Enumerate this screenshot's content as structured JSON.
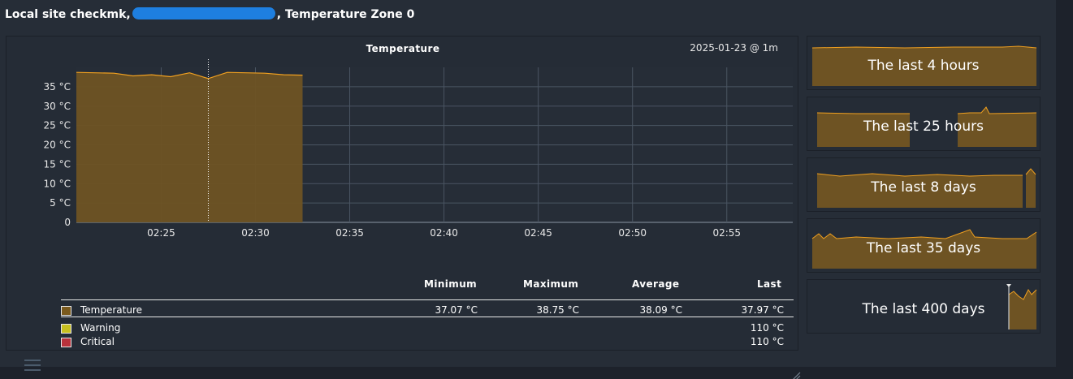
{
  "header": {
    "title_prefix": "Local site checkmk,",
    "title_suffix": ", Temperature Zone 0"
  },
  "graph": {
    "title": "Temperature",
    "date_label": "2025-01-23 @ 1m"
  },
  "legend": {
    "headers": [
      "Minimum",
      "Maximum",
      "Average",
      "Last"
    ],
    "rows": [
      {
        "label": "Temperature",
        "color": "#7a5a1e",
        "min": "37.07 °C",
        "max": "38.75 °C",
        "avg": "38.09 °C",
        "last": "37.97 °C"
      },
      {
        "label": "Warning",
        "color": "#c8c020",
        "min": "",
        "max": "",
        "avg": "",
        "last": "110 °C"
      },
      {
        "label": "Critical",
        "color": "#b8323c",
        "min": "",
        "max": "",
        "avg": "",
        "last": "110 °C"
      }
    ]
  },
  "timeranges": [
    {
      "label": "The last 4 hours"
    },
    {
      "label": "The last 25 hours"
    },
    {
      "label": "The last 8 days"
    },
    {
      "label": "The last 35 days"
    },
    {
      "label": "The last 400 days"
    }
  ],
  "chart_data": {
    "type": "area",
    "title": "Temperature",
    "xlabel": "",
    "ylabel": "",
    "x_ticks": [
      "02:25",
      "02:30",
      "02:35",
      "02:40",
      "02:45",
      "02:50",
      "02:55"
    ],
    "y_ticks": [
      "0",
      "5 °C",
      "10 °C",
      "15 °C",
      "20 °C",
      "25 °C",
      "30 °C",
      "35 °C"
    ],
    "ylim": [
      0,
      40
    ],
    "xlim_minutes": [
      "02:20:30",
      "02:58:30"
    ],
    "grid": true,
    "fill_color": "#6e5323",
    "line_color": "#f0a020",
    "marker_time": "02:27:30",
    "series": [
      {
        "name": "Temperature",
        "x": [
          "02:20:30",
          "02:21:30",
          "02:22:30",
          "02:23:30",
          "02:24:30",
          "02:25:30",
          "02:26:30",
          "02:27:30",
          "02:28:30",
          "02:29:30",
          "02:30:30",
          "02:31:30",
          "02:32:30"
        ],
        "values": [
          38.7,
          38.6,
          38.5,
          37.8,
          38.1,
          37.6,
          38.6,
          37.1,
          38.7,
          38.6,
          38.5,
          38.1,
          38.0
        ]
      }
    ]
  }
}
